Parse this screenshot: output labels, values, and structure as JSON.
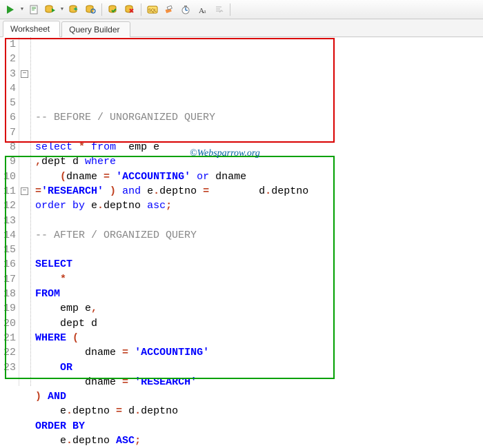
{
  "toolbar": {
    "icons": [
      "run",
      "script",
      "db-run",
      "db-commit",
      "db-rollback",
      "db-save",
      "db-cancel",
      "explain",
      "sql-recall",
      "eraser",
      "timer",
      "font",
      "format"
    ]
  },
  "tabs": {
    "worksheet": "Worksheet",
    "querybuilder": "Query Builder"
  },
  "watermark": "©Websparrow.org",
  "code": {
    "lines": [
      {
        "n": "1",
        "fold": "",
        "html": "<span class='cmt'>-- BEFORE / UNORGANIZED QUERY</span>"
      },
      {
        "n": "2",
        "fold": "",
        "html": ""
      },
      {
        "n": "3",
        "fold": "minus",
        "html": "<span class='kw2'>select</span> <span class='op'>*</span> <span class='kw2'>from</span>  emp e"
      },
      {
        "n": "4",
        "fold": "",
        "html": "<span class='op'>,</span>dept d <span class='kw2'>where</span>"
      },
      {
        "n": "5",
        "fold": "",
        "html": "    <span class='op'>(</span>dname <span class='op'>=</span> <span class='str'>'ACCOUNTING'</span> <span class='kw2'>or</span> dname"
      },
      {
        "n": "6",
        "fold": "",
        "html": "<span class='op'>=</span><span class='str'>'RESEARCH'</span> <span class='op'>)</span> <span class='kw2'>and</span> e<span class='op'>.</span>deptno <span class='op'>=</span>        d<span class='op'>.</span>deptno"
      },
      {
        "n": "7",
        "fold": "",
        "html": "<span class='kw2'>order by</span> e<span class='op'>.</span>deptno <span class='kw2'>asc</span><span class='op'>;</span>"
      },
      {
        "n": "8",
        "fold": "",
        "html": ""
      },
      {
        "n": "9",
        "fold": "",
        "html": "<span class='cmt'>-- AFTER / ORGANIZED QUERY</span>"
      },
      {
        "n": "10",
        "fold": "",
        "html": ""
      },
      {
        "n": "11",
        "fold": "minus",
        "html": "<span class='kw'>SELECT</span>"
      },
      {
        "n": "12",
        "fold": "",
        "html": "    <span class='op'>*</span>"
      },
      {
        "n": "13",
        "fold": "",
        "html": "<span class='kw'>FROM</span>"
      },
      {
        "n": "14",
        "fold": "",
        "html": "    emp e<span class='op'>,</span>"
      },
      {
        "n": "15",
        "fold": "",
        "html": "    dept d"
      },
      {
        "n": "16",
        "fold": "",
        "html": "<span class='kw'>WHERE</span> <span class='op'>(</span>"
      },
      {
        "n": "17",
        "fold": "",
        "html": "        dname <span class='op'>=</span> <span class='str'>'ACCOUNTING'</span>"
      },
      {
        "n": "18",
        "fold": "",
        "html": "    <span class='kw'>OR</span>"
      },
      {
        "n": "19",
        "fold": "",
        "html": "        dname <span class='op'>=</span> <span class='str'>'RESEARCH'</span>"
      },
      {
        "n": "20",
        "fold": "",
        "html": "<span class='op'>)</span> <span class='kw'>AND</span>"
      },
      {
        "n": "21",
        "fold": "",
        "html": "    e<span class='op'>.</span>deptno <span class='op'>=</span> d<span class='op'>.</span>deptno"
      },
      {
        "n": "22",
        "fold": "",
        "html": "<span class='kw'>ORDER BY</span>"
      },
      {
        "n": "23",
        "fold": "",
        "html": "    e<span class='op'>.</span>deptno <span class='kw'>ASC</span><span class='op'>;</span>"
      }
    ]
  }
}
